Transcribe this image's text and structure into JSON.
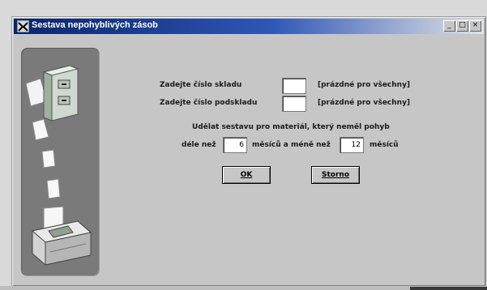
{
  "window": {
    "title": "Sestava nepohyblivých zásob",
    "controls": [
      "_",
      "□",
      "×"
    ]
  },
  "form": {
    "warehouse_label": "Zadejte číslo skladu",
    "warehouse_value": "",
    "warehouse_hint": "[prázdné pro všechny]",
    "subwarehouse_label": "Zadejte číslo podskladu",
    "subwarehouse_value": "",
    "subwarehouse_hint": "[prázdné pro všechny]",
    "report_text": "Udělat sestavu pro materiál, který neměl pohyb",
    "longer_label": "déle než",
    "longer_value": "6",
    "months_and_less_label": "měsíců a méně než",
    "less_value": "12",
    "months_label": "měsíců"
  },
  "buttons": {
    "ok": "OK",
    "cancel": "Storno"
  },
  "icons": {
    "app": "app-icon",
    "side": "printer-report-illustration"
  }
}
